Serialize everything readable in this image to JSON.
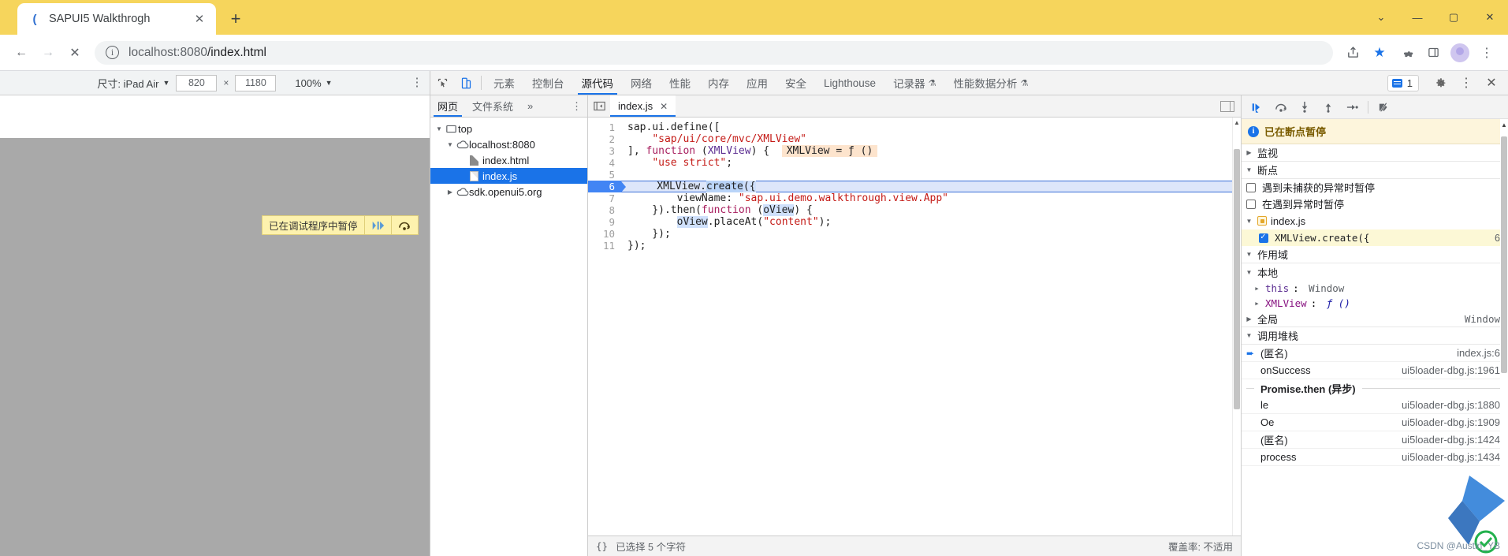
{
  "browser": {
    "tab": {
      "title": "SAPUI5 Walkthrogh",
      "favicon": "sapui5-favicon",
      "close_label": "✕"
    },
    "new_tab_label": "+",
    "window_controls": {
      "list": "⌄",
      "minimize": "—",
      "maximize": "▢",
      "close": "✕"
    },
    "toolbar": {
      "back": "←",
      "forward": "→",
      "stop": "✕",
      "info_icon": "ⓘ",
      "url_host": "localhost:8080",
      "url_path": "/index.html",
      "share": "share-icon",
      "star": "★",
      "extensions": "puzzle-icon",
      "sidepanel": "panel-icon",
      "menu": "⋮"
    }
  },
  "device_toolbar": {
    "size_label": "尺寸: iPad Air",
    "caret": "▼",
    "width": "820",
    "x": "×",
    "height": "1180",
    "zoom": "100%",
    "zoom_caret": "▼",
    "more": "⋮"
  },
  "page_overlay": {
    "paused_text": "已在调试程序中暂停",
    "resume_icon": "▶|",
    "step_icon": "⤻"
  },
  "devtools": {
    "inspect_icon": "inspect-cursor-icon",
    "device_icon": "device-toggle-icon",
    "tabs": [
      {
        "label": "元素",
        "selected": false
      },
      {
        "label": "控制台",
        "selected": false
      },
      {
        "label": "源代码",
        "selected": true
      },
      {
        "label": "网络",
        "selected": false
      },
      {
        "label": "性能",
        "selected": false
      },
      {
        "label": "内存",
        "selected": false
      },
      {
        "label": "应用",
        "selected": false
      },
      {
        "label": "安全",
        "selected": false
      },
      {
        "label": "Lighthouse",
        "selected": false
      },
      {
        "label": "记录器",
        "selected": false,
        "flask": true
      },
      {
        "label": "性能数据分析",
        "selected": false,
        "flask": true
      }
    ],
    "messages_count": "1",
    "settings_icon": "gear-icon",
    "more_icon": "⋮",
    "close_icon": "✕"
  },
  "navigator": {
    "tabs": [
      {
        "label": "网页",
        "selected": true
      },
      {
        "label": "文件系统",
        "selected": false
      }
    ],
    "overflow": "»",
    "more": "⋮",
    "tree": [
      {
        "label": "top",
        "indent": 0,
        "twisty": "▼",
        "icon": "frame-icon",
        "selected": false
      },
      {
        "label": "localhost:8080",
        "indent": 1,
        "twisty": "▼",
        "icon": "cloud-icon",
        "selected": false
      },
      {
        "label": "index.html",
        "indent": 2,
        "twisty": "",
        "icon": "file-grey-icon",
        "selected": false
      },
      {
        "label": "index.js",
        "indent": 2,
        "twisty": "",
        "icon": "file-white-icon",
        "selected": true
      },
      {
        "label": "sdk.openui5.org",
        "indent": 1,
        "twisty": "▶",
        "icon": "cloud-icon",
        "selected": false
      }
    ]
  },
  "editor": {
    "panel_toggle_icon": "show-navigator-icon",
    "tab": {
      "label": "index.js",
      "close": "✕"
    },
    "split_icon": "split-editor-icon",
    "code_lines": [
      {
        "n": "1",
        "text": "sap.ui.define(["
      },
      {
        "n": "2",
        "text": "    \"sap/ui/core/mvc/XMLView\""
      },
      {
        "n": "3",
        "text": "], function (XMLView) {",
        "inline_value": "XMLView = ƒ ()"
      },
      {
        "n": "4",
        "text": "    \"use strict\";"
      },
      {
        "n": "5",
        "text": ""
      },
      {
        "n": "6",
        "text": "    XMLView.create({",
        "breakpoint": true
      },
      {
        "n": "7",
        "text": "        viewName: \"sap.ui.demo.walkthrough.view.App\""
      },
      {
        "n": "8",
        "text": "    }).then(function (oView) {"
      },
      {
        "n": "9",
        "text": "        oView.placeAt(\"content\");"
      },
      {
        "n": "10",
        "text": "    });"
      },
      {
        "n": "11",
        "text": "});"
      }
    ],
    "status": {
      "format_icon": "{}",
      "selection": "已选择 5 个字符",
      "coverage": "覆盖率: 不适用"
    }
  },
  "debugger": {
    "toolbar": {
      "resume": "resume-script-icon",
      "step_over": "step-over-icon",
      "step_into": "step-into-icon",
      "step_out": "step-out-icon",
      "step": "step-icon",
      "deactivate_breakpoints": "deactivate-breakpoints-icon"
    },
    "paused_banner": "已在断点暂停",
    "sections": {
      "watch": "监视",
      "breakpoints": "断点",
      "scope": "作用域",
      "call_stack": "调用堆栈"
    },
    "pause_options": [
      {
        "label": "遇到未捕获的异常时暂停",
        "checked": false
      },
      {
        "label": "在遇到异常时暂停",
        "checked": false
      }
    ],
    "breakpoint_file": "index.js",
    "breakpoints": [
      {
        "code": "XMLView.create({",
        "line": "6",
        "checked": true
      }
    ],
    "scope_local_label": "本地",
    "scope_local": [
      {
        "name": "this",
        "value": "Window"
      },
      {
        "name": "XMLView",
        "value": "ƒ ()"
      }
    ],
    "scope_global_label": "全局",
    "scope_global_value": "Window",
    "call_stack": [
      {
        "name": "(匿名)",
        "location": "index.js:6",
        "current": true
      },
      {
        "name": "onSuccess",
        "location": "ui5loader-dbg.js:1961",
        "current": false
      },
      {
        "name": "Promise.then (异步)",
        "async": true
      },
      {
        "name": "le",
        "location": "ui5loader-dbg.js:1880",
        "current": false
      },
      {
        "name": "Oe",
        "location": "ui5loader-dbg.js:1909",
        "current": false
      },
      {
        "name": "(匿名)",
        "location": "ui5loader-dbg.js:1424",
        "current": false
      },
      {
        "name": "process",
        "location": "ui5loader-dbg.js:1434",
        "current": false
      }
    ]
  },
  "watermark": {
    "text": "CSDN @Austin_YB"
  }
}
